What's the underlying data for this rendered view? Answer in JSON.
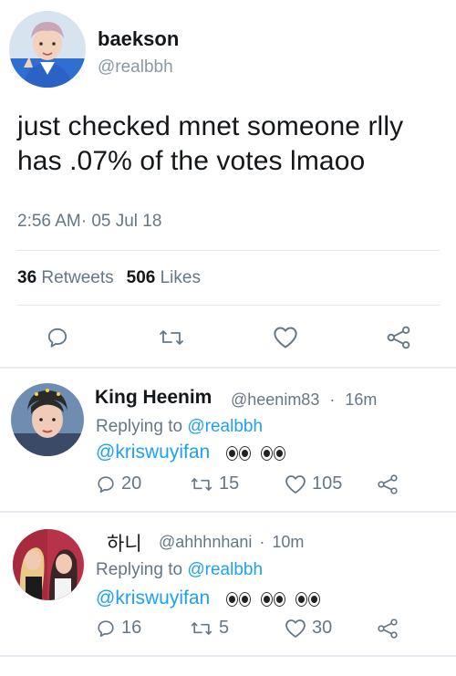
{
  "tweet": {
    "author_name": "baekson",
    "author_handle": "@realbbh",
    "text": "just checked mnet someone rlly has .07% of the votes lmaoo",
    "time": "2:56 AM",
    "separator": "·",
    "date": "05 Jul 18",
    "retweets_count": "36",
    "retweets_label": "Retweets",
    "likes_count": "506",
    "likes_label": "Likes"
  },
  "actions": {
    "reply_icon": "reply-icon",
    "retweet_icon": "retweet-icon",
    "like_icon": "heart-icon",
    "share_icon": "share-icon"
  },
  "replies": [
    {
      "name": "King Heenim",
      "handle": "@heenim83",
      "dot": "·",
      "time": "16m",
      "replying_prefix": "Replying to",
      "replying_to": "@realbbh",
      "mention": "@kriswuyifan",
      "eye_emoji_count": 2,
      "reply_count": "20",
      "retweet_count": "15",
      "like_count": "105"
    },
    {
      "name": "하니",
      "handle": "@ahhhnhani",
      "dot": "·",
      "time": "10m",
      "replying_prefix": "Replying to",
      "replying_to": "@realbbh",
      "mention": "@kriswuyifan",
      "eye_emoji_count": 3,
      "reply_count": "16",
      "retweet_count": "5",
      "like_count": "30"
    }
  ],
  "colors": {
    "link": "#1da1f2",
    "muted": "#657786",
    "text": "#14171a",
    "divider": "#e1e8ed"
  }
}
